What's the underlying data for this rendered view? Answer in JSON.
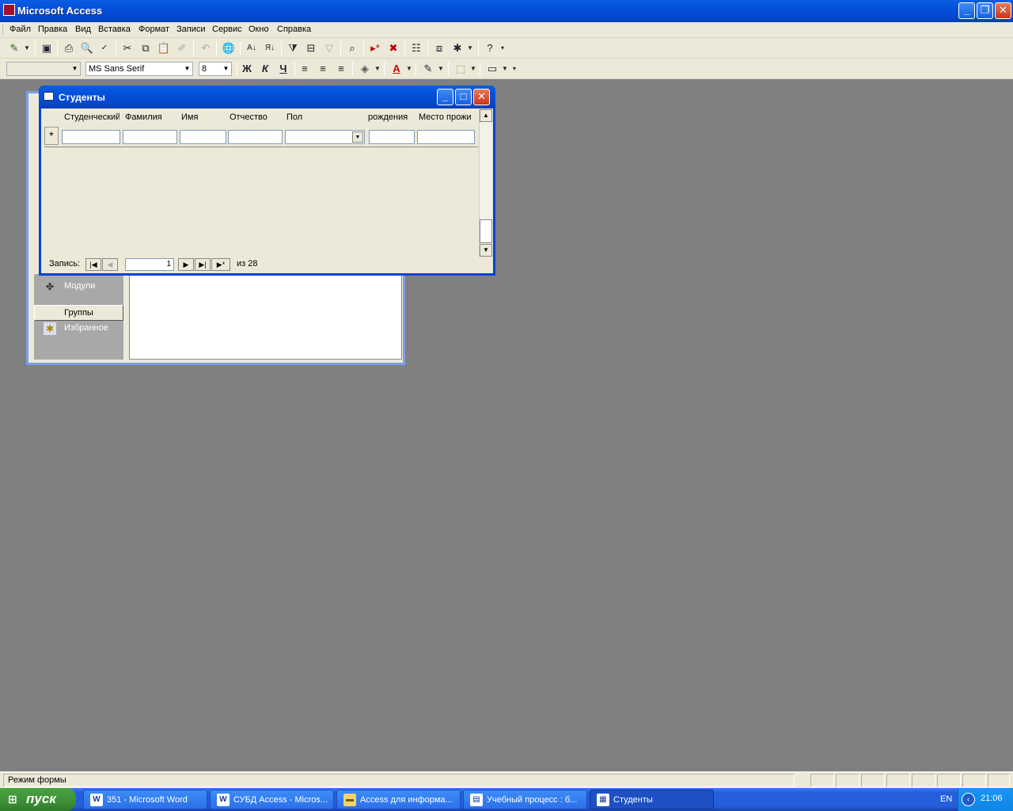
{
  "app": {
    "title": "Microsoft Access"
  },
  "menu": [
    "Файл",
    "Правка",
    "Вид",
    "Вставка",
    "Формат",
    "Записи",
    "Сервис",
    "Окно",
    "Справка"
  ],
  "formatting": {
    "font": "MS Sans Serif",
    "size": "8",
    "bold": "Ж",
    "italic": "К",
    "underline": "Ч"
  },
  "db_window": {
    "items": [
      {
        "label": "Модули",
        "icon": "module-icon"
      },
      {
        "label": "Избранное",
        "icon": "favorites-icon"
      }
    ],
    "groups_label": "Группы"
  },
  "form": {
    "title": "Студенты",
    "columns": [
      "Студенческий",
      "Фамилия",
      "Имя",
      "Отчество",
      "Пол",
      "рождения",
      "Место прожи"
    ],
    "new_record_marker": "*",
    "nav": {
      "label": "Запись:",
      "current": "1",
      "of": "из",
      "total": "28"
    }
  },
  "status": {
    "text": "Режим формы"
  },
  "taskbar": {
    "start": "пуск",
    "tasks": [
      {
        "label": "351 - Microsoft Word",
        "icon": "word-icon"
      },
      {
        "label": "СУБД Access - Micros...",
        "icon": "word-icon"
      },
      {
        "label": "Access для информа...",
        "icon": "folder-icon"
      },
      {
        "label": "Учебный процесс : б...",
        "icon": "database-icon"
      },
      {
        "label": "Студенты",
        "icon": "form-icon"
      }
    ],
    "lang": "EN",
    "clock": "21:06"
  }
}
